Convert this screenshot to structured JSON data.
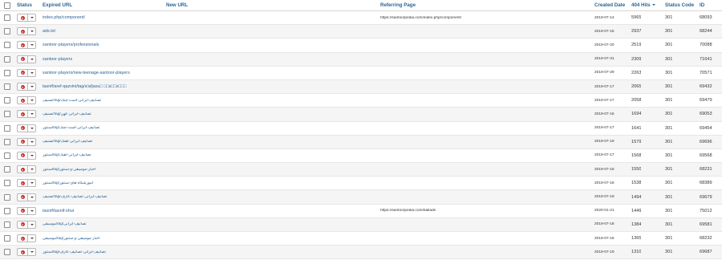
{
  "headers": {
    "status": "Status",
    "expired_url": "Expired URL",
    "new_url": "New URL",
    "referring_page": "Referring Page",
    "created_date": "Created Date",
    "hits": "404 Hits",
    "status_code": "Status Code",
    "id": "ID"
  },
  "colors": {
    "link": "#2a6496",
    "status_unpublished": "#c9302c",
    "row_alt": "#f5f5f5"
  },
  "icons": {
    "status": "unpublished-x-icon",
    "toggle": "caret-down-icon",
    "sort": "sort-desc-icon"
  },
  "rows": [
    {
      "expired": "index.php/component/",
      "ref": "https://santoorpedia.com/index.php/component/",
      "date": "2019-07-14",
      "hits": "5965",
      "code": "301",
      "id": "68093"
    },
    {
      "expired": "ads.txt",
      "ref": "",
      "date": "2019-07-15",
      "hits": "2937",
      "code": "301",
      "id": "68244"
    },
    {
      "expired": "santoor-players/professionals",
      "ref": "",
      "date": "2019-07-20",
      "hits": "2519",
      "code": "301",
      "id": "70088"
    },
    {
      "expired": "santoor-players",
      "ref": "",
      "date": "2019-07-31",
      "hits": "2309",
      "code": "301",
      "id": "71641"
    },
    {
      "expired": "santoor-players/new-teenage-santoor-players",
      "ref": "",
      "date": "2019-07-29",
      "hits": "2263",
      "code": "301",
      "id": "70571"
    },
    {
      "expired": "tasnif/aref-qazvini/tag/a'ařjasu□ □□s□□s□□□",
      "ref": "",
      "date": "2019-07-17",
      "hits": "2065",
      "code": "301",
      "id": "69432"
    },
    {
      "expired": "تصنیف/tag/تصانیف-ایرانی-است-چنگ",
      "ref": "",
      "date": "2019-07-17",
      "hits": "2058",
      "code": "301",
      "id": "69479"
    },
    {
      "expired": "تصنیف/tag/تصانیف-ایرانی-کهن",
      "ref": "",
      "date": "2019-07-16",
      "hits": "1694",
      "code": "301",
      "id": "69053"
    },
    {
      "expired": "سنتور/tag/تصانیف-ایرانی-است-چنگ",
      "ref": "",
      "date": "2019-07-17",
      "hits": "1641",
      "code": "301",
      "id": "69454"
    },
    {
      "expired": "تصنیف/tag/تصانیف-ایرانی-آهنگ",
      "ref": "",
      "date": "2019-07-19",
      "hits": "1579",
      "code": "301",
      "id": "69696"
    },
    {
      "expired": "سنتور/tag/تصانیف-ایرانی-آهنگ",
      "ref": "",
      "date": "2019-07-17",
      "hits": "1568",
      "code": "301",
      "id": "69568"
    },
    {
      "expired": "سنتور/tag/اخبار-موسیقی-و-سنتور",
      "ref": "",
      "date": "2019-07-15",
      "hits": "1550",
      "code": "301",
      "id": "68231"
    },
    {
      "expired": "سنتور/tag/آموزشگاه-های-سنتور",
      "ref": "",
      "date": "2019-07-16",
      "hits": "1538",
      "code": "301",
      "id": "68389"
    },
    {
      "expired": "تصنیف/tag/تصانیف-ایرانی-تصانیف-عارف",
      "ref": "",
      "date": "2019-07-19",
      "hits": "1494",
      "code": "301",
      "id": "69679"
    },
    {
      "expired": "tasnif/tasnif-shur",
      "ref": "https://santoorpedia.com/ballads",
      "date": "2020-01-21",
      "hits": "1449",
      "code": "301",
      "id": "75012"
    },
    {
      "expired": "موسیقی/tag/تصانیف-ایرانی",
      "ref": "",
      "date": "2019-07-18",
      "hits": "1384",
      "code": "301",
      "id": "69581"
    },
    {
      "expired": "موسیقی/tag/اخبار-موسیقی-و-سنتور",
      "ref": "",
      "date": "2019-07-15",
      "hits": "1365",
      "code": "301",
      "id": "68232"
    },
    {
      "expired": "سنتور/tag/تصانیف-ایرانی-تصانیف-عارف",
      "ref": "",
      "date": "2019-07-19",
      "hits": "1310",
      "code": "301",
      "id": "69687"
    }
  ]
}
